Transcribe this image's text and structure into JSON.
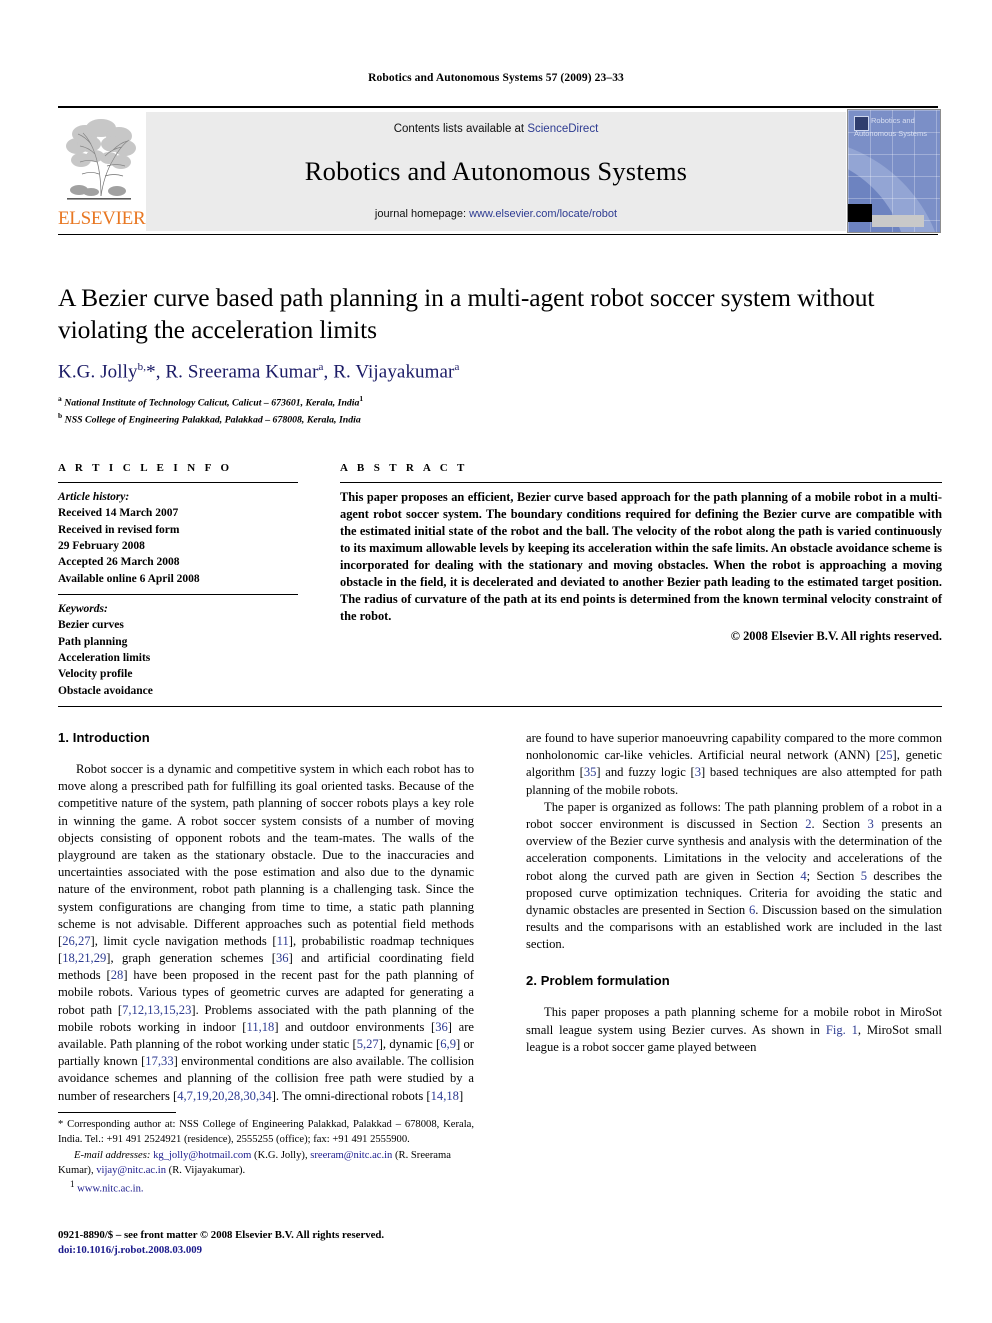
{
  "running_head": "Robotics and Autonomous Systems 57 (2009) 23–33",
  "masthead": {
    "publisher_name": "ELSEVIER",
    "contents_prefix": "Contents lists available at ",
    "contents_link": "ScienceDirect",
    "journal_title": "Robotics and Autonomous Systems",
    "homepage_prefix": "journal homepage: ",
    "homepage_url": "www.elsevier.com/locate/robot",
    "cover": {
      "line1": "Robotics and",
      "line2": "Autonomous Systems"
    }
  },
  "article": {
    "title": "A Bezier curve based path planning in a multi-agent robot soccer system without violating the acceleration limits",
    "authors_html": "K.G. Jolly<sup>b,</sup>*, R. Sreerama Kumar<sup>a</sup>, R. Vijayakumar<sup>a</sup>",
    "affiliation_a": "National Institute of Technology Calicut, Calicut – 673601, Kerala, India",
    "affiliation_b": "NSS College of Engineering Palakkad, Palakkad – 678008, Kerala, India"
  },
  "article_info": {
    "heading": "A R T I C L E   I N F O",
    "history_label": "Article history:",
    "history": [
      "Received 14 March 2007",
      "Received in revised form",
      "29 February 2008",
      "Accepted 26 March 2008",
      "Available online 6 April 2008"
    ],
    "keywords_label": "Keywords:",
    "keywords": [
      "Bezier curves",
      "Path planning",
      "Acceleration limits",
      "Velocity profile",
      "Obstacle avoidance"
    ]
  },
  "abstract": {
    "heading": "A B S T R A C T",
    "text": "This paper proposes an efficient, Bezier curve based approach for the path planning of a mobile robot in a multi-agent robot soccer system. The boundary conditions required for defining the Bezier curve are compatible with the estimated initial state of the robot and the ball. The velocity of the robot along the path is varied continuously to its maximum allowable levels by keeping its acceleration within the safe limits. An obstacle avoidance scheme is incorporated for dealing with the stationary and moving obstacles. When the robot is approaching a moving obstacle in the field, it is decelerated and deviated to another Bezier path leading to the estimated target position. The radius of curvature of the path at its end points is determined from the known terminal velocity constraint of the robot.",
    "copyright": "© 2008 Elsevier B.V. All rights reserved."
  },
  "sections": {
    "introduction": {
      "number_title": "1. Introduction",
      "para1_html": "Robot soccer is a dynamic and competitive system in which each robot has to move along a prescribed path for fulfilling its goal oriented tasks. Because of the competitive nature of the system, path planning of soccer robots plays a key role in winning the game. A robot soccer system consists of a number of moving objects consisting of opponent robots and the team-mates. The walls of the playground are taken as the stationary obstacle. Due to the inaccuracies and uncertainties associated with the pose estimation and also due to the dynamic nature of the environment, robot path planning is a challenging task. Since the system configurations are changing from time to time, a static path planning scheme is not advisable. Different approaches such as potential field methods [<span class=\"cite\">26,27</span>], limit cycle navigation methods [<span class=\"cite\">11</span>], probabilistic roadmap techniques [<span class=\"cite\">18,21,29</span>], graph generation schemes [<span class=\"cite\">36</span>] and artificial coordinating field methods [<span class=\"cite\">28</span>] have been proposed in the recent past for the path planning of mobile robots. Various types of geometric curves are adapted for generating a robot path [<span class=\"cite\">7,12,13,15,23</span>]. Problems associated with the path planning of the mobile robots working in indoor [<span class=\"cite\">11,18</span>] and outdoor environments [<span class=\"cite\">36</span>] are available. Path planning of the robot working under static [<span class=\"cite\">5,27</span>], dynamic [<span class=\"cite\">6,9</span>] or partially known [<span class=\"cite\">17,33</span>] environmental conditions are also available. The collision avoidance schemes and planning of the collision free path were studied by a number of researchers [<span class=\"cite\">4,7,19,20,28,30,34</span>]. The omni-directional robots [<span class=\"cite\">14,18</span>] are found to have superior manoeuvring capability compared to the more common nonholonomic car-like vehicles. Artificial neural network (ANN) [<span class=\"cite\">25</span>], genetic algorithm [<span class=\"cite\">35</span>] and fuzzy logic [<span class=\"cite\">3</span>] based techniques are also attempted for path planning of the mobile robots.",
      "para2_html": "The paper is organized as follows: The path planning problem of a robot in a robot soccer environment is discussed in Section <span class=\"cite\">2</span>. Section <span class=\"cite\">3</span> presents an overview of the Bezier curve synthesis and analysis with the determination of the acceleration components. Limitations in the velocity and accelerations of the robot along the curved path are given in Section <span class=\"cite\">4</span>; Section <span class=\"cite\">5</span> describes the proposed curve optimization techniques. Criteria for avoiding the static and dynamic obstacles are presented in Section <span class=\"cite\">6</span>. Discussion based on the simulation results and the comparisons with an established work are included in the last section."
    },
    "problem_formulation": {
      "number_title": "2. Problem formulation",
      "para1_html": "This paper proposes a path planning scheme for a mobile robot in MiroSot small league system using Bezier curves. As shown in <span class=\"cite\">Fig. 1</span>, MiroSot small league is a robot soccer game played between"
    }
  },
  "footnotes": {
    "corresponding_html": "* Corresponding author at: NSS College of Engineering Palakkad, Palakkad – 678008, Kerala, India. Tel.: +91 491 2524921 (residence), 2555255 (office); fax: +91 491 2555900.",
    "email_label": "E-mail addresses:",
    "emails_html": " <span class=\"link\">kg_jolly@hotmail.com</span> (K.G. Jolly), <span class=\"link\">sreeram@nitc.ac.in</span> (R. Sreerama Kumar), <span class=\"link\">vijay@nitc.ac.in</span> (R. Vijayakumar).",
    "url_marker": "1",
    "url": "www.nitc.ac.in."
  },
  "imprint": {
    "line1": "0921-8890/$ – see front matter © 2008 Elsevier B.V. All rights reserved.",
    "doi": "doi:10.1016/j.robot.2008.03.009"
  }
}
